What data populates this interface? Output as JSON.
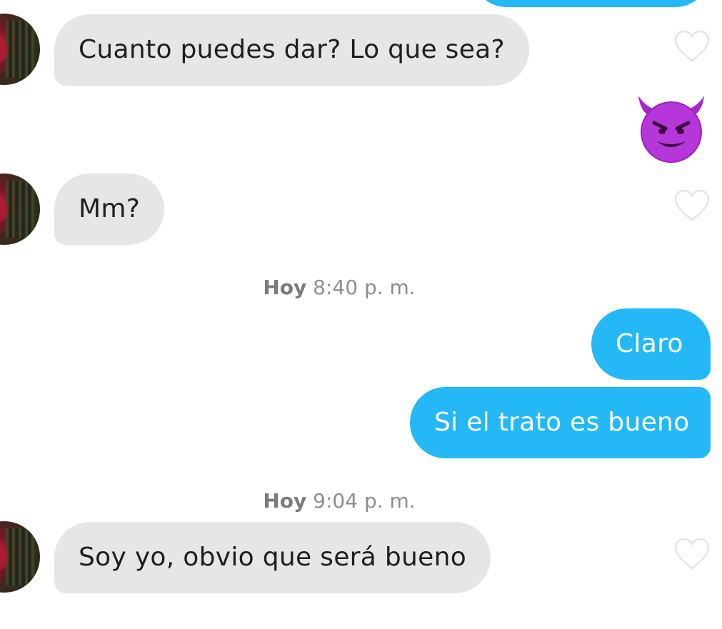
{
  "messages": [
    {
      "text": "Cuanto puedes dar? Lo que sea?"
    },
    {
      "emoji": "smiling-face-with-horns"
    },
    {
      "text": "Mm?"
    },
    {
      "text": "Claro"
    },
    {
      "text": "Si el trato es bueno"
    },
    {
      "text": "Soy yo, obvio que será bueno"
    }
  ],
  "timestamps": [
    {
      "day": "Hoy",
      "time": "8:40",
      "period": "p. m."
    },
    {
      "day": "Hoy",
      "time": "9:04",
      "period": "p. m."
    }
  ],
  "colors": {
    "outgoing_bubble": "#24b8f7",
    "incoming_bubble": "#e6e6e6",
    "emoji_purple": "#b02bd6"
  },
  "icons": {
    "like": "heart-outline-icon",
    "emoji": "smiling-face-with-horns-icon"
  }
}
